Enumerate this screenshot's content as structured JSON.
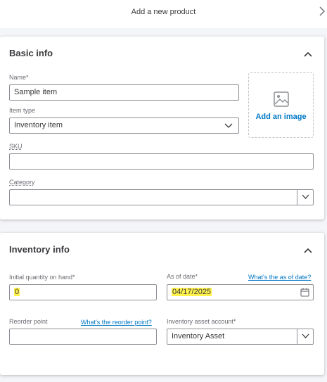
{
  "header": {
    "title": "Add a new product",
    "close_icon": "chevron-right-icon"
  },
  "basic_info": {
    "title": "Basic info",
    "name": {
      "label": "Name*",
      "value": "Sample item"
    },
    "item_type": {
      "label": "Item type",
      "value": "Inventory item"
    },
    "sku": {
      "label": "SKU",
      "value": ""
    },
    "category": {
      "label": "Category",
      "value": ""
    },
    "image": {
      "label": "Add an image",
      "icon": "image-icon"
    }
  },
  "inventory_info": {
    "title": "Inventory info",
    "initial_qty": {
      "label": "Initial quantity on hand*",
      "value": "0"
    },
    "as_of_date": {
      "label": "As of date*",
      "help_link": "What's the as of date?",
      "value": "04/17/2025"
    },
    "reorder_point": {
      "label": "Reorder point",
      "help_link": "What's the reorder point?",
      "value": ""
    },
    "asset_account": {
      "label": "Inventory asset account*",
      "value": "Inventory Asset"
    }
  },
  "colors": {
    "link": "#0077c5",
    "highlight": "#fff24a",
    "text": "#393a3d"
  }
}
